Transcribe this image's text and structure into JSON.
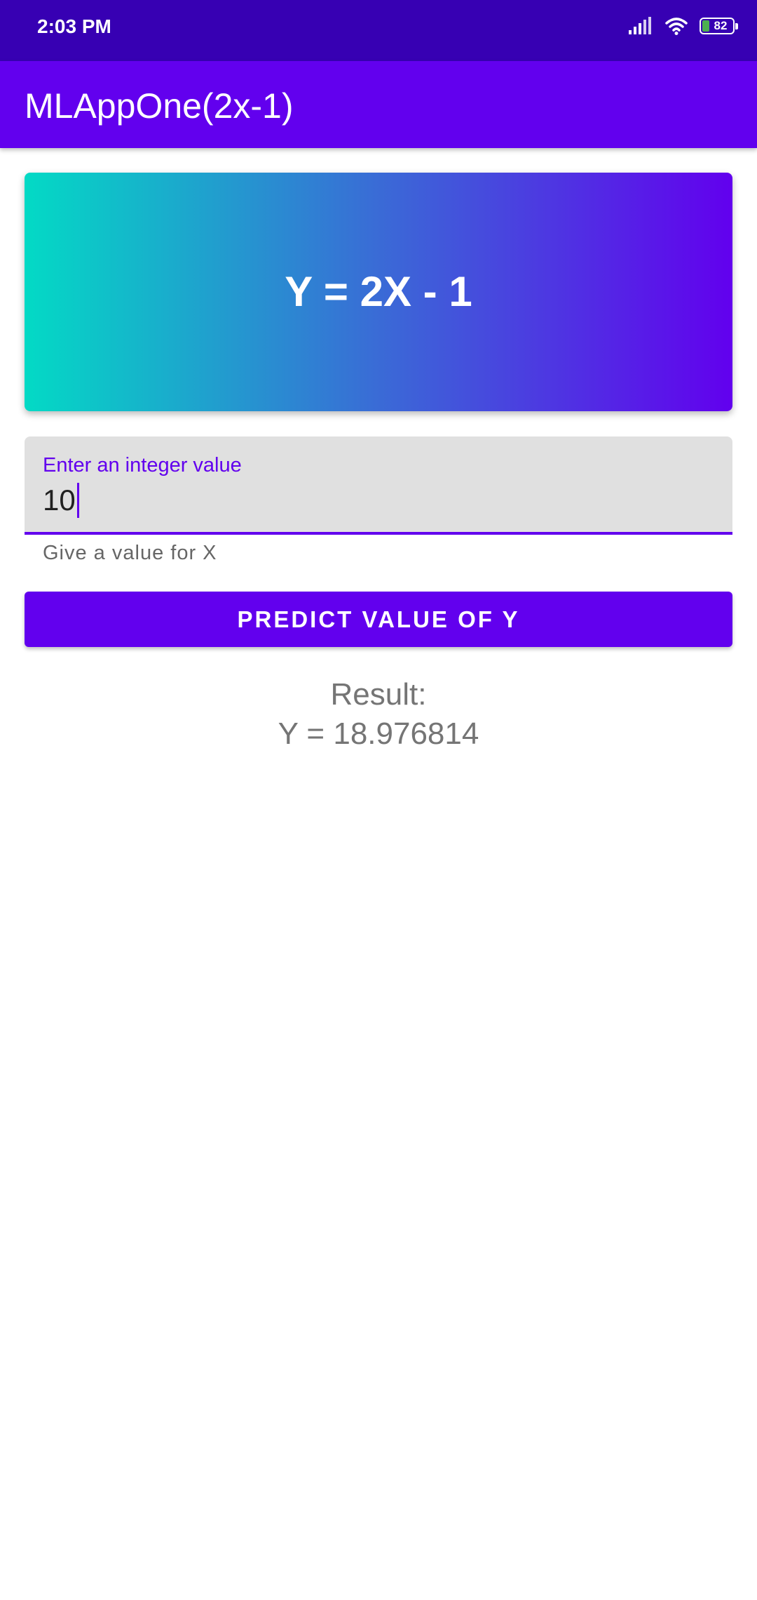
{
  "status_bar": {
    "time": "2:03 PM",
    "battery_level": "82",
    "icons": [
      "signal-icon",
      "wifi-icon",
      "battery-icon"
    ]
  },
  "app_bar": {
    "title": "MLAppOne(2x-1)"
  },
  "formula_card": {
    "formula": "Y = 2X - 1",
    "gradient_colors": [
      "#03dac5",
      "#6200ee"
    ]
  },
  "input": {
    "label": "Enter an integer value",
    "value": "10",
    "helper_text": "Give a value for X"
  },
  "predict_button": {
    "label": "PREDICT VALUE OF Y"
  },
  "result": {
    "heading": "Result:",
    "value_text": "Y = 18.976814"
  },
  "colors": {
    "status_bar": "#3700b3",
    "primary": "#6200ee",
    "input_background": "#e0e0e0",
    "result_text": "#757575"
  }
}
